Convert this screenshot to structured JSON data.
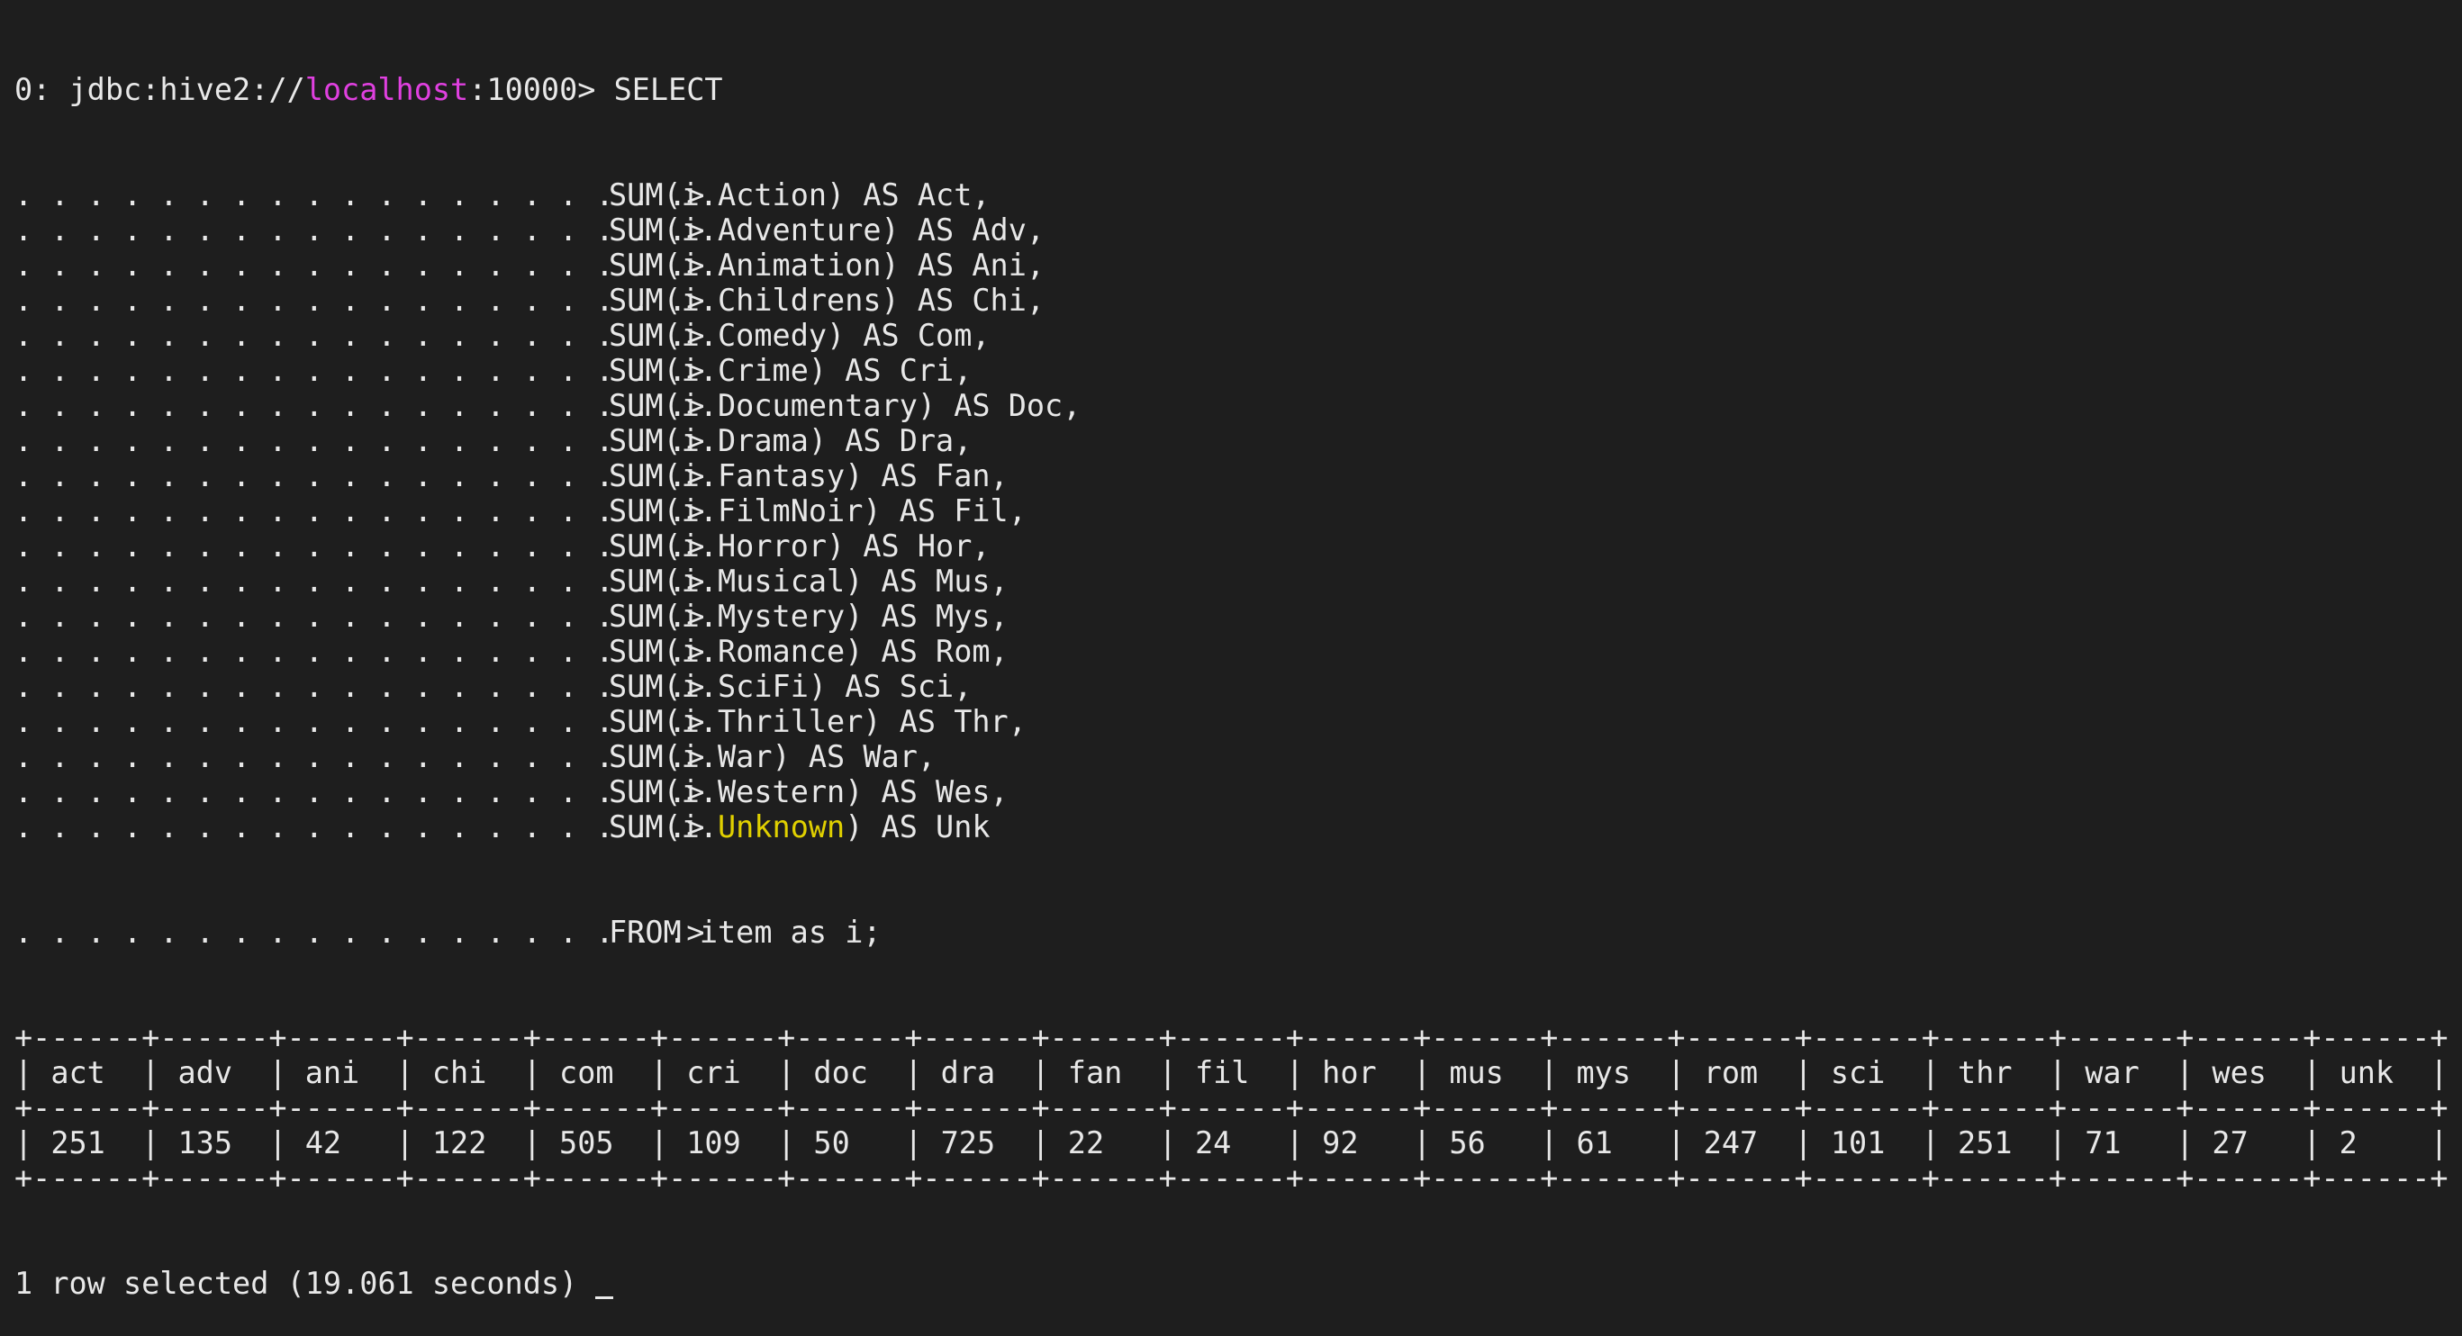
{
  "terminal": {
    "prompt": {
      "prefix": "0: jdbc:hive2://",
      "host": "localhost",
      "port_and_arrow": ":10000> ",
      "command": "SELECT"
    },
    "continuation_prefix": ". . . . . . . . . . . . . . . . . . .> ",
    "query_lines": [
      {
        "before": "SUM(i.",
        "field": "Action",
        "after": ") AS Act,"
      },
      {
        "before": "SUM(i.",
        "field": "Adventure",
        "after": ") AS Adv,"
      },
      {
        "before": "SUM(i.",
        "field": "Animation",
        "after": ") AS Ani,"
      },
      {
        "before": "SUM(i.",
        "field": "Childrens",
        "after": ") AS Chi,"
      },
      {
        "before": "SUM(i.",
        "field": "Comedy",
        "after": ") AS Com,"
      },
      {
        "before": "SUM(i.",
        "field": "Crime",
        "after": ") AS Cri,"
      },
      {
        "before": "SUM(i.",
        "field": "Documentary",
        "after": ") AS Doc,"
      },
      {
        "before": "SUM(i.",
        "field": "Drama",
        "after": ") AS Dra,"
      },
      {
        "before": "SUM(i.",
        "field": "Fantasy",
        "after": ") AS Fan,"
      },
      {
        "before": "SUM(i.",
        "field": "FilmNoir",
        "after": ") AS Fil,"
      },
      {
        "before": "SUM(i.",
        "field": "Horror",
        "after": ") AS Hor,"
      },
      {
        "before": "SUM(i.",
        "field": "Musical",
        "after": ") AS Mus,"
      },
      {
        "before": "SUM(i.",
        "field": "Mystery",
        "after": ") AS Mys,"
      },
      {
        "before": "SUM(i.",
        "field": "Romance",
        "after": ") AS Rom,"
      },
      {
        "before": "SUM(i.",
        "field": "SciFi",
        "after": ") AS Sci,"
      },
      {
        "before": "SUM(i.",
        "field": "Thriller",
        "after": ") AS Thr,"
      },
      {
        "before": "SUM(i.",
        "field": "War",
        "after": ") AS War,"
      },
      {
        "before": "SUM(i.",
        "field": "Western",
        "after": ") AS Wes,"
      },
      {
        "before": "SUM(i.",
        "field": "Unknown",
        "after": ") AS Unk",
        "highlight": true
      }
    ],
    "from_line": "FROM item as i;",
    "result_table": {
      "border": "+------+------+------+------+------+------+------+------+------+------+------+------+------+------+------+------+------+------+------+",
      "headers": [
        "act",
        "adv",
        "ani",
        "chi",
        "com",
        "cri",
        "doc",
        "dra",
        "fan",
        "fil",
        "hor",
        "mus",
        "mys",
        "rom",
        "sci",
        "thr",
        "war",
        "wes",
        "unk"
      ],
      "rows": [
        [
          "251",
          "135",
          "42",
          "122",
          "505",
          "109",
          "50",
          "725",
          "22",
          "24",
          "92",
          "56",
          "61",
          "247",
          "101",
          "251",
          "71",
          "27",
          "2"
        ]
      ]
    },
    "status": "1 row selected (19.061 seconds)",
    "colors": {
      "background": "#1e1e1e",
      "text": "#e8e8e8",
      "host": "#e040e0",
      "highlight_keyword": "#e0d000"
    }
  }
}
